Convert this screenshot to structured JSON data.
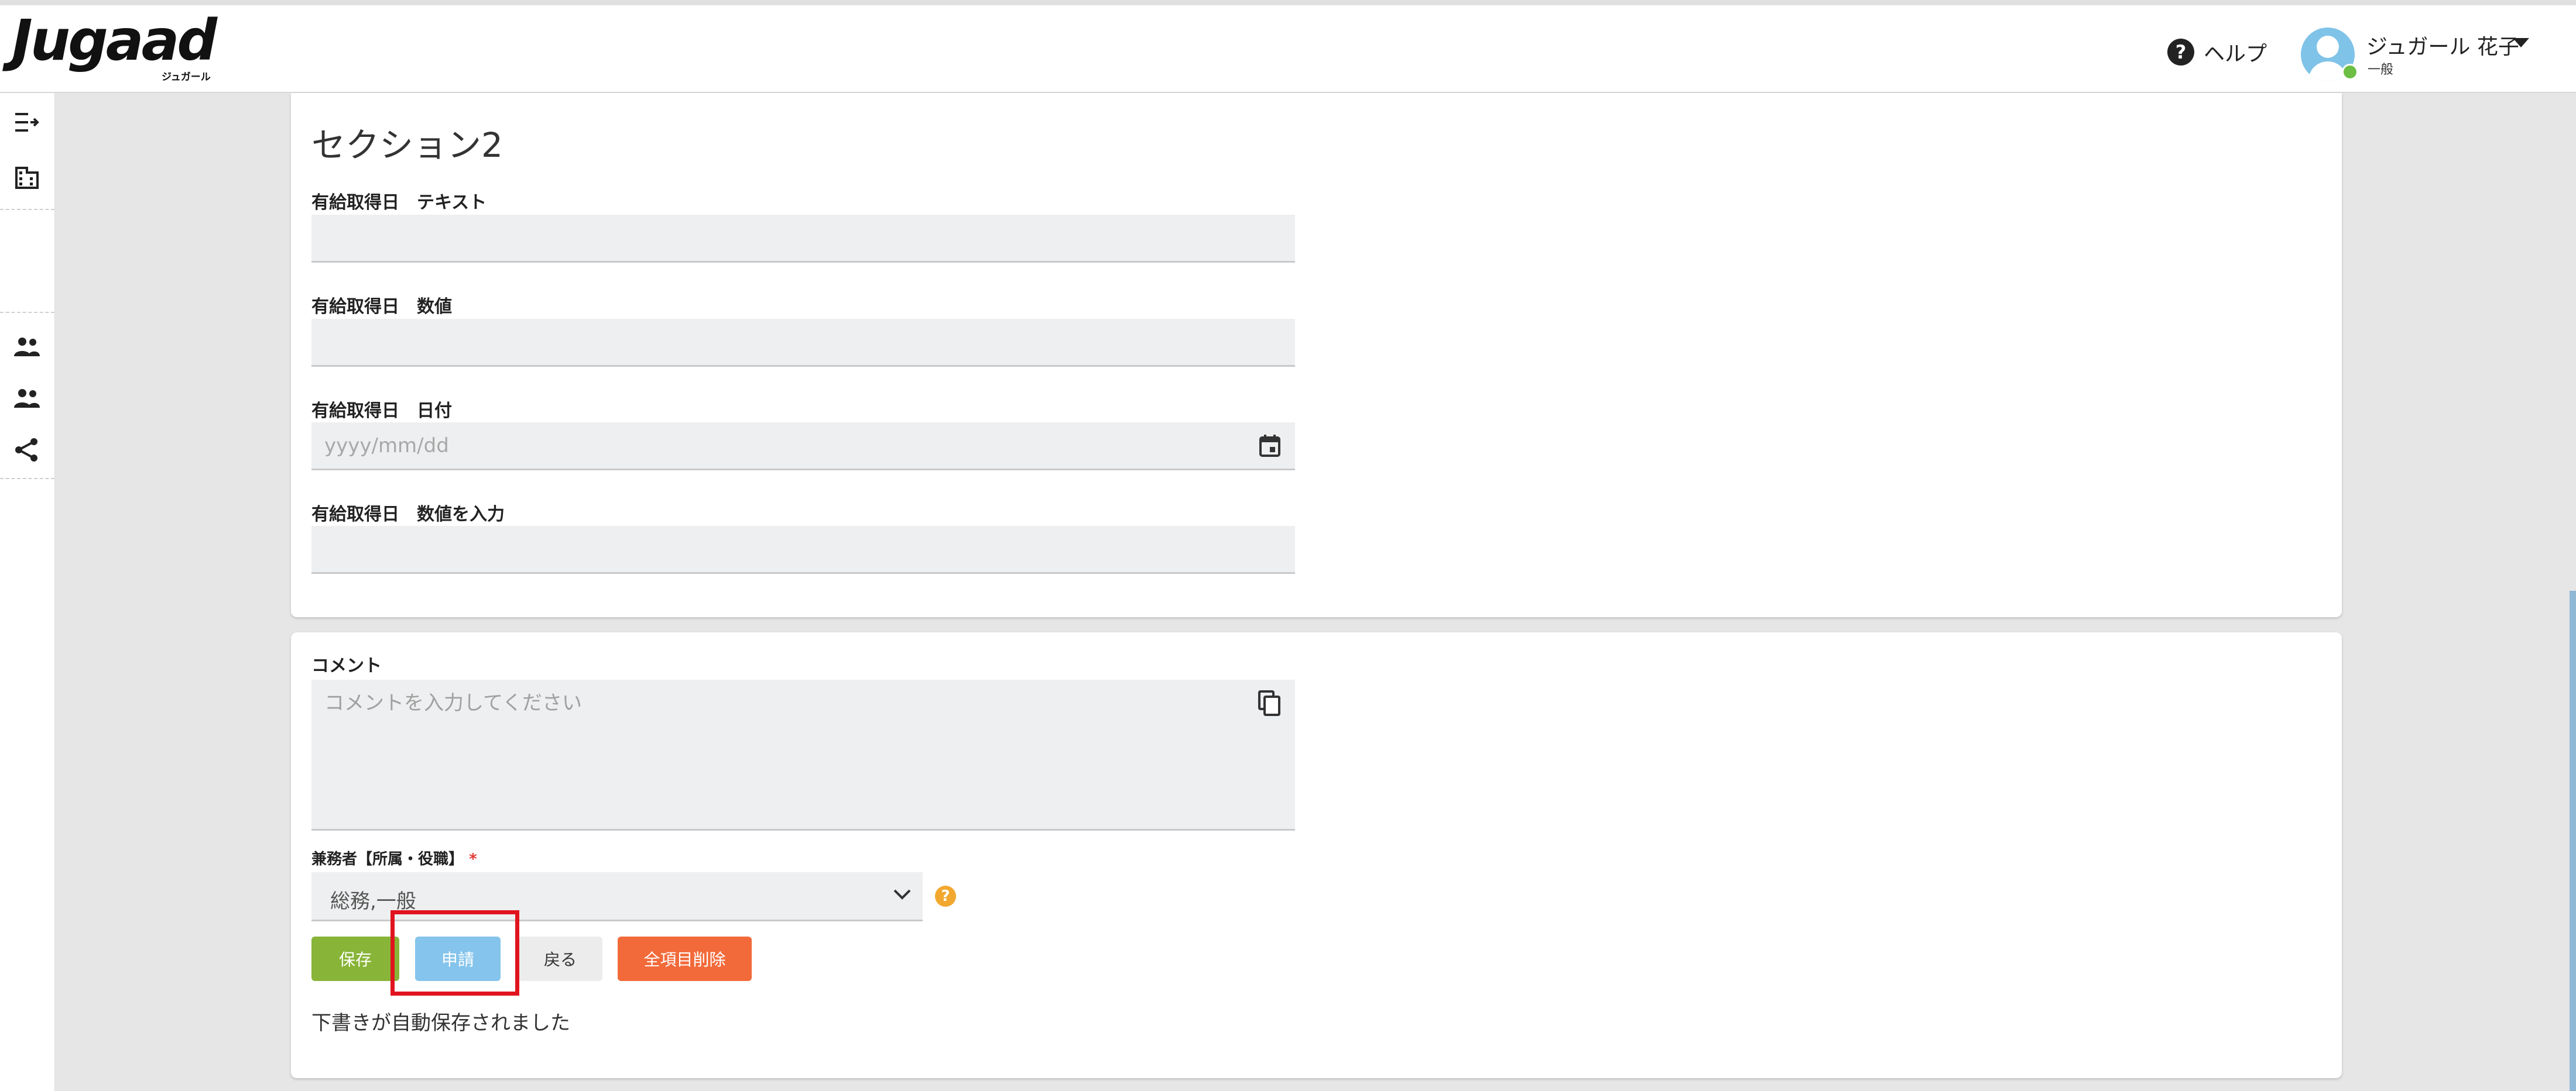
{
  "header": {
    "logo_text": "Jugaad",
    "logo_sub": "ジュガール",
    "help_label": "ヘルプ",
    "user_name": "ジュガール 花子",
    "user_role": "一般"
  },
  "sidebar": {
    "icons": [
      "menu-expand-icon",
      "building-icon",
      "people-icon",
      "people-icon",
      "share-icon"
    ]
  },
  "section": {
    "title": "セクション2",
    "fields": [
      {
        "label": "有給取得日　テキスト",
        "value": ""
      },
      {
        "label": "有給取得日　数値",
        "value": ""
      },
      {
        "label": "有給取得日　日付",
        "placeholder": "yyyy/mm/dd"
      },
      {
        "label": "有給取得日　数値を入力",
        "value": ""
      }
    ]
  },
  "comment": {
    "label": "コメント",
    "placeholder": "コメントを入力してください"
  },
  "concurrent": {
    "label": "兼務者【所属・役職】",
    "required_mark": "*",
    "selected": "総務,一般"
  },
  "buttons": {
    "save": "保存",
    "apply": "申請",
    "back": "戻る",
    "delete_all": "全項目削除"
  },
  "status_message": "下書きが自動保存されました",
  "colors": {
    "save": "#88b438",
    "apply": "#85c4ec",
    "delete": "#f26a3a",
    "highlight": "#e0141e"
  }
}
